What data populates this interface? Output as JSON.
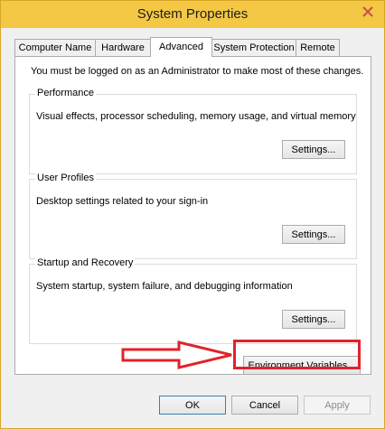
{
  "window": {
    "title": "System Properties",
    "close_icon": "close-icon",
    "accent_color": "#f4c744",
    "close_color": "#c75050"
  },
  "tabs": [
    {
      "label": "Computer Name",
      "active": false
    },
    {
      "label": "Hardware",
      "active": false
    },
    {
      "label": "Advanced",
      "active": true
    },
    {
      "label": "System Protection",
      "active": false
    },
    {
      "label": "Remote",
      "active": false
    }
  ],
  "advanced": {
    "notice": "You must be logged on as an Administrator to make most of these changes.",
    "performance": {
      "title": "Performance",
      "description": "Visual effects, processor scheduling, memory usage, and virtual memory",
      "button": "Settings..."
    },
    "user_profiles": {
      "title": "User Profiles",
      "description": "Desktop settings related to your sign-in",
      "button": "Settings..."
    },
    "startup_recovery": {
      "title": "Startup and Recovery",
      "description": "System startup, system failure, and debugging information",
      "button": "Settings..."
    },
    "env_button": "Environment Variables..."
  },
  "footer": {
    "ok": "OK",
    "cancel": "Cancel",
    "apply": "Apply"
  },
  "annotation": {
    "arrow_icon": "right-arrow-icon",
    "color": "#e1222a"
  }
}
